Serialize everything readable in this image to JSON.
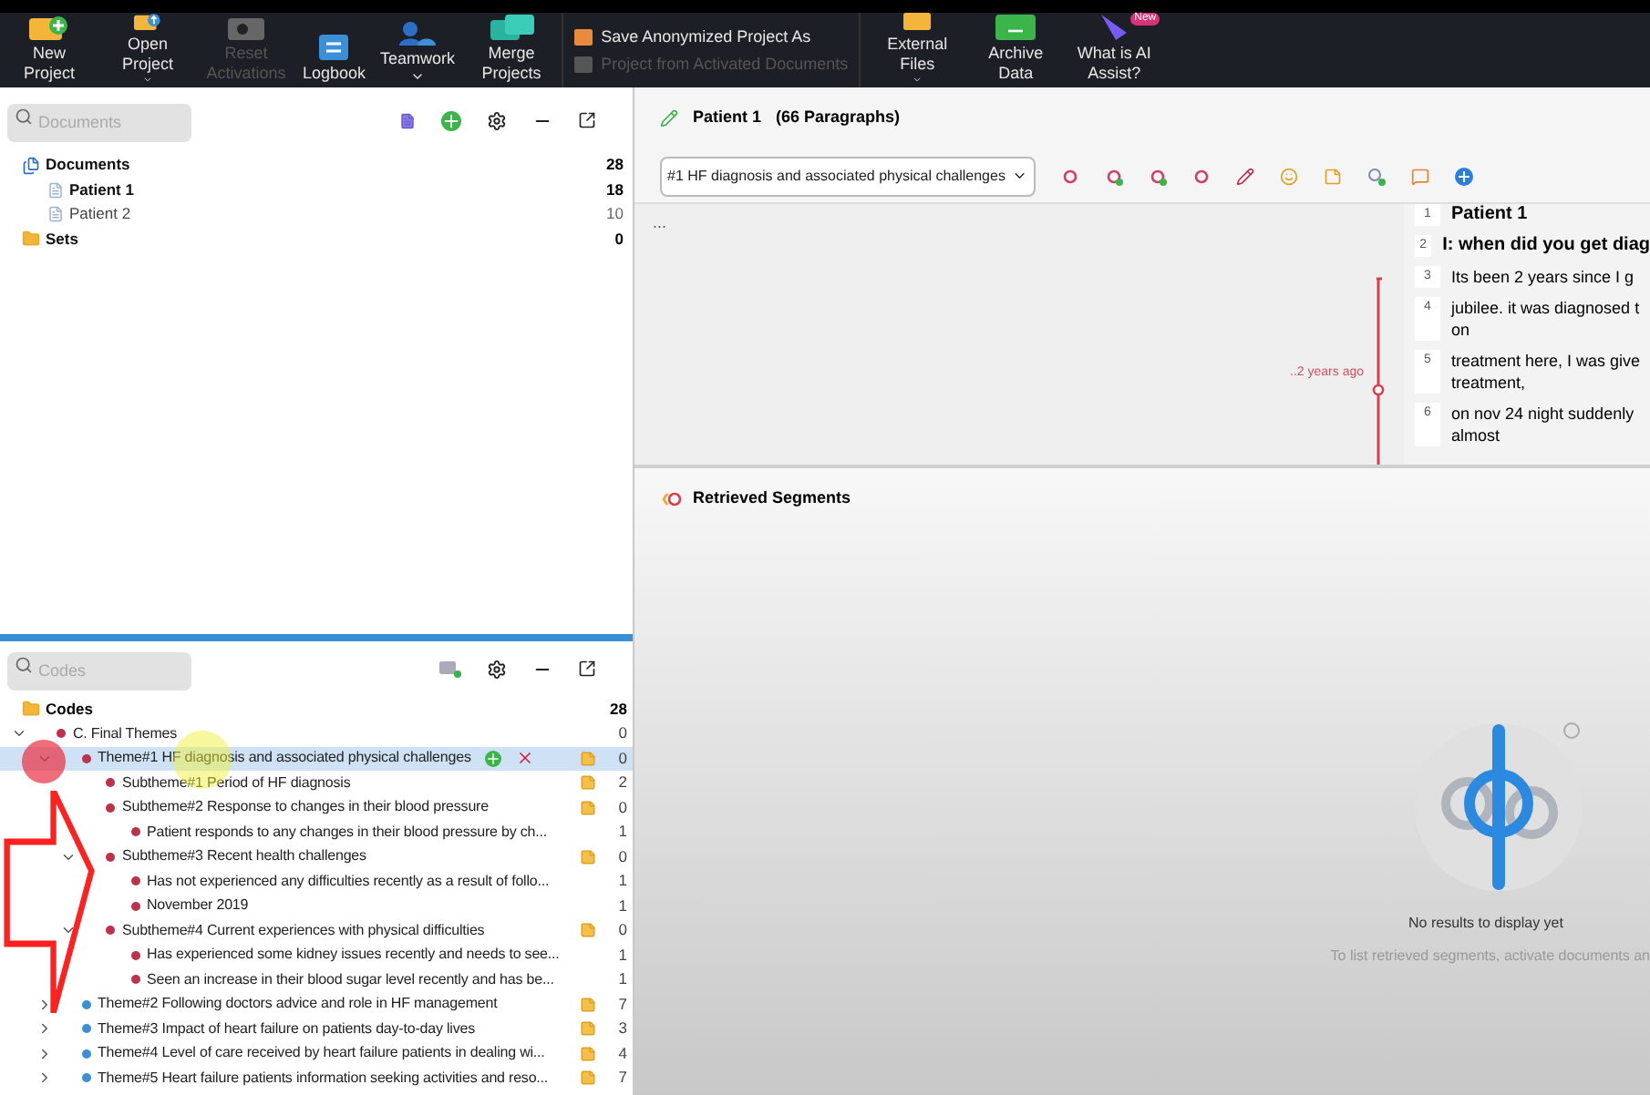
{
  "toolbar": [
    {
      "kind": "big",
      "label": "New Project",
      "disabled": false,
      "dropdown": false
    },
    {
      "kind": "big",
      "label": "Open Project",
      "disabled": false,
      "dropdown": true
    },
    {
      "kind": "big",
      "label": "Reset Activations",
      "disabled": true,
      "dropdown": false
    },
    {
      "kind": "big",
      "label": "Logbook",
      "disabled": false,
      "dropdown": false
    },
    {
      "kind": "big",
      "label": "Teamwork",
      "disabled": false,
      "dropdown": true
    },
    {
      "kind": "big",
      "label": "Merge Projects",
      "disabled": false,
      "dropdown": false
    },
    {
      "kind": "stack",
      "items": [
        {
          "label": "Save Anonymized Project As",
          "disabled": false
        },
        {
          "label": "Project from Activated Documents",
          "disabled": true
        }
      ]
    },
    {
      "kind": "big",
      "label": "External Files",
      "disabled": false,
      "dropdown": true
    },
    {
      "kind": "big",
      "label": "Archive Data",
      "disabled": false,
      "dropdown": false
    },
    {
      "kind": "big",
      "label": "What is AI Assist?",
      "disabled": false,
      "dropdown": false,
      "badge": "New"
    }
  ],
  "documents": {
    "search_placeholder": "Documents",
    "items": [
      {
        "kind": "root",
        "label": "Documents",
        "count": "28",
        "bold": true,
        "children": [
          {
            "kind": "doc",
            "label": "Patient 1",
            "count": "18",
            "bold": true
          },
          {
            "kind": "doc",
            "label": "Patient 2",
            "count": "10",
            "bold": false
          }
        ]
      },
      {
        "kind": "sets",
        "label": "Sets",
        "count": "0",
        "bold": true
      }
    ]
  },
  "codes": {
    "search_placeholder": "Codes",
    "root": {
      "label": "Codes",
      "count": "28"
    },
    "items": [
      {
        "label": "C. Final Themes",
        "count": "0",
        "color": "#c0304a",
        "expanded": true,
        "memo": false,
        "selected": false,
        "children": [
          {
            "label": "Theme#1 HF diagnosis and associated physical challenges",
            "count": "0",
            "color": "#c0304a",
            "expanded": true,
            "memo": true,
            "selected": true,
            "children": [
              {
                "label": "Subtheme#1 Period of HF diagnosis",
                "count": "2",
                "color": "#c0304a",
                "memo": true,
                "selected": false
              },
              {
                "label": "Subtheme#2 Response to changes in their blood pressure",
                "count": "0",
                "color": "#c0304a",
                "memo": true,
                "selected": false,
                "children": [
                  {
                    "label": "Patient responds to any changes in their blood pressure by ch...",
                    "count": "1",
                    "color": "#c0304a",
                    "memo": false,
                    "selected": false
                  }
                ]
              },
              {
                "label": "Subtheme#3 Recent health challenges",
                "count": "0",
                "color": "#c0304a",
                "memo": true,
                "selected": false,
                "expanded": true,
                "children": [
                  {
                    "label": "Has not experienced any difficulties recently as a result of follo...",
                    "count": "1",
                    "color": "#c0304a",
                    "memo": false,
                    "selected": false
                  },
                  {
                    "label": "November 2019",
                    "count": "1",
                    "color": "#c0304a",
                    "memo": false,
                    "selected": false
                  }
                ]
              },
              {
                "label": "Subtheme#4 Current experiences with physical difficulties",
                "count": "0",
                "color": "#c0304a",
                "memo": true,
                "selected": false,
                "expanded": true,
                "children": [
                  {
                    "label": "Has experienced some kidney issues recently and needs to see...",
                    "count": "1",
                    "color": "#c0304a",
                    "memo": false,
                    "selected": false
                  },
                  {
                    "label": "Seen an increase in their blood sugar level recently and has be...",
                    "count": "1",
                    "color": "#c0304a",
                    "memo": false,
                    "selected": false
                  }
                ]
              }
            ]
          },
          {
            "label": "Theme#2 Following doctors advice and role in HF management",
            "count": "7",
            "color": "#3a8fd6",
            "expanded": false,
            "memo": true,
            "selected": false
          },
          {
            "label": "Theme#3 Impact of heart failure on patients day-to-day lives",
            "count": "3",
            "color": "#3a8fd6",
            "expanded": false,
            "memo": true,
            "selected": false
          },
          {
            "label": "Theme#4 Level of care received  by heart failure patients in  dealing wi...",
            "count": "4",
            "color": "#3a8fd6",
            "expanded": false,
            "memo": true,
            "selected": false
          },
          {
            "label": "Theme#5 Heart failure patients information seeking activities and reso...",
            "count": "7",
            "color": "#3a8fd6",
            "expanded": false,
            "memo": true,
            "selected": false
          }
        ]
      }
    ]
  },
  "document_browser": {
    "title": "Patient 1",
    "subtitle": "(66 Paragraphs)",
    "code_select": "#1 HF diagnosis and associated physical challenges",
    "ellipsis": "...",
    "segment_label": "..2 years ago",
    "paragraphs": [
      {
        "number": "1",
        "lines": [
          "Patient 1"
        ],
        "bold": true
      },
      {
        "number": "2",
        "lines": [
          "I: when did you get diag"
        ],
        "bold": true
      },
      {
        "number": "3",
        "lines": [
          "Its been 2 years since I g"
        ],
        "bold": false
      },
      {
        "number": "4",
        "lines": [
          "jubilee. it was diagnosed t",
          "on"
        ],
        "bold": false
      },
      {
        "number": "5",
        "lines": [
          "treatment here, I was give",
          "treatment,"
        ],
        "bold": false
      },
      {
        "number": "6",
        "lines": [
          "on nov 24 night suddenly",
          "almost"
        ],
        "bold": false
      }
    ]
  },
  "retrieved_segments": {
    "title": "Retrieved Segments",
    "empty_title": "No results to display yet",
    "empty_hint": "To list retrieved segments, activate documents an"
  }
}
